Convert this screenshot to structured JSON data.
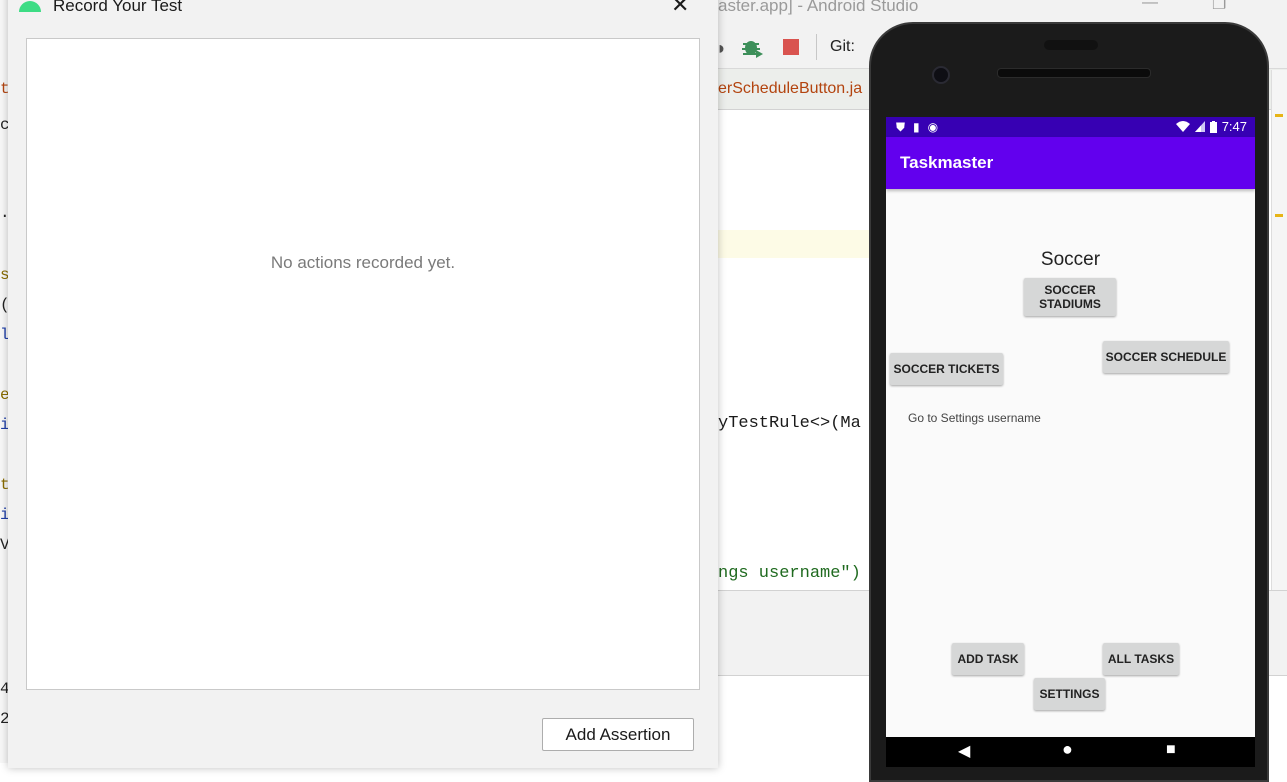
{
  "ide": {
    "title": "aster.app] - Android Studio",
    "git_label": "Git:",
    "tab_label": "erScheduleButton.ja",
    "code_line_1": "yTestRule<>(Ma",
    "code_line_2": "ngs username\")",
    "left_chars": [
      "t",
      "c",
      ".",
      "s",
      "(",
      "l",
      "e",
      "i",
      "t",
      "i",
      "V",
      "4",
      "2"
    ]
  },
  "dialog": {
    "title": "Record Your Test",
    "empty_message": "No actions recorded yet.",
    "add_assertion_label": "Add Assertion",
    "close_glyph": "✕"
  },
  "phone": {
    "status_time": "7:47",
    "app_title": "Taskmaster",
    "heading": "Soccer",
    "buttons": {
      "stadiums_line1": "SOCCER",
      "stadiums_line2": "STADIUMS",
      "tickets": "SOCCER TICKETS",
      "schedule": "SOCCER SCHEDULE",
      "add_task": "ADD TASK",
      "all_tasks": "ALL TASKS",
      "settings": "SETTINGS"
    },
    "settings_username_label": "Go to Settings username",
    "nav": {
      "back": "◀",
      "home": "●",
      "recents": "■"
    }
  },
  "colors": {
    "status_bar": "#3700b3",
    "app_bar": "#6200ee",
    "stop_button": "#d9534f",
    "android_green": "#3ddc84"
  },
  "icons": [
    "android-icon",
    "close-icon",
    "debug-icon",
    "stop-icon",
    "wifi-icon",
    "signal-icon",
    "battery-icon"
  ]
}
